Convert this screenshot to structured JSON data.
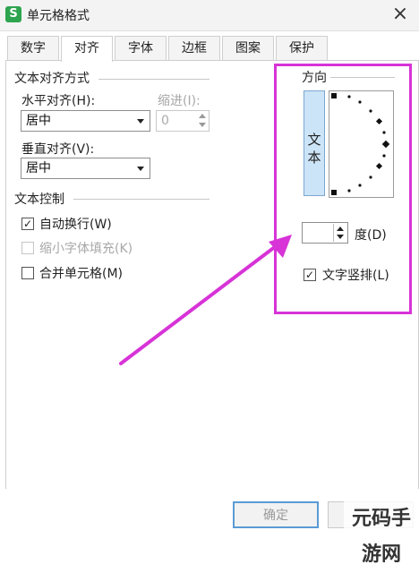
{
  "window": {
    "title": "单元格格式",
    "app_icon_letter": "S",
    "close_glyph": "×"
  },
  "tabs": [
    {
      "label": "数字"
    },
    {
      "label": "对齐"
    },
    {
      "label": "字体"
    },
    {
      "label": "边框"
    },
    {
      "label": "图案"
    },
    {
      "label": "保护"
    }
  ],
  "active_tab": "对齐",
  "alignment": {
    "group_title": "文本对齐方式",
    "horizontal_label": "水平对齐(H):",
    "horizontal_value": "居中",
    "indent_label": "缩进(I):",
    "indent_value": "0",
    "vertical_label": "垂直对齐(V):",
    "vertical_value": "居中"
  },
  "text_control": {
    "group_title": "文本控制",
    "wrap_label": "自动换行(W)",
    "wrap_checked": true,
    "shrink_label": "缩小字体填充(K)",
    "shrink_checked": false,
    "merge_label": "合并单元格(M)",
    "merge_checked": false
  },
  "orientation": {
    "group_title": "方向",
    "vertical_text": "文本",
    "degree_value": "",
    "degree_label": "度(D)",
    "vertical_stack_label": "文字竖排(L)",
    "vertical_stack_checked": true
  },
  "buttons": {
    "ok_label": "确定"
  },
  "watermark": "元码手游网",
  "colors": {
    "highlight": "#d733d7",
    "arrow": "#d733d7"
  }
}
